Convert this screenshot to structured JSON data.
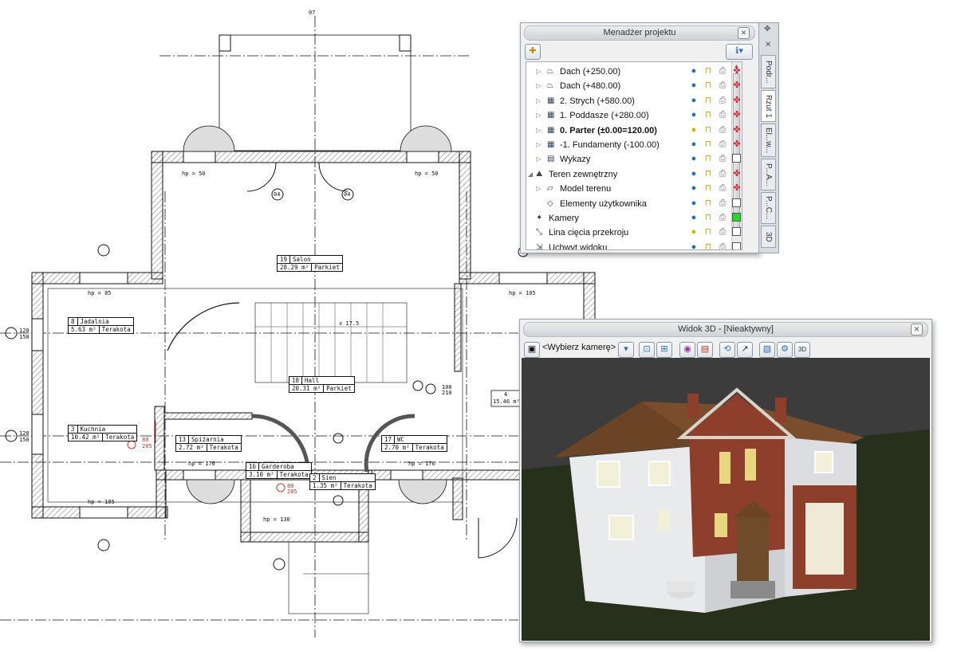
{
  "drawing": {
    "north_label": "07",
    "rooms": [
      {
        "num": "19",
        "name": "Salon",
        "area": "28.29 m²",
        "floor": "Parkiet"
      },
      {
        "num": "8",
        "name": "Jadalnia",
        "area": "5.63 m²",
        "floor": "Terakota"
      },
      {
        "num": "18",
        "name": "Hall",
        "area": "20.31 m²",
        "floor": "Parkiet"
      },
      {
        "num": "3",
        "name": "Kuchnia",
        "area": "10.42 m²",
        "floor": "Terakota"
      },
      {
        "num": "13",
        "name": "Spiżarnia",
        "area": "2.72 m²",
        "floor": "Terakota"
      },
      {
        "num": "16",
        "name": "Garderoba",
        "area": "3.10 m²",
        "floor": "Terakota"
      },
      {
        "num": "2",
        "name": "Sien",
        "area": "1.35 m²",
        "floor": "Terakota"
      },
      {
        "num": "17",
        "name": "WC",
        "area": "2.70 m²",
        "floor": "Terakota"
      },
      {
        "num": "4",
        "name": "",
        "area": "15.46 m²",
        "floor": ""
      }
    ],
    "labels": {
      "hp50a": "hp = 50",
      "hp50b": "hp = 50",
      "hp85": "hp = 85",
      "hp105a": "hp = 105",
      "hp176a": "hp = 176",
      "hp176b": "hp = 176",
      "hp105b": "hp = 105",
      "hp130": "hp = 130",
      "d04a": "04",
      "d04b": "04",
      "w120a": "120",
      "w150a": "150",
      "w120b": "120",
      "w150b": "150",
      "s175": "x 17.5",
      "r80a": "80",
      "r205a": "205",
      "r80b": "80",
      "r205b": "205",
      "d100": "100",
      "d210": "210"
    }
  },
  "project_manager": {
    "title": "Menadżer projektu",
    "tree": [
      {
        "label": "Dach (+250.00)",
        "bold": false,
        "indent": 1,
        "icon": "roof-icon",
        "bulb": "blue",
        "state": "layers"
      },
      {
        "label": "Dach (+480.00)",
        "bold": false,
        "indent": 1,
        "icon": "roof-icon",
        "bulb": "blue",
        "state": "layers"
      },
      {
        "label": "2. Strych (+580.00)",
        "bold": false,
        "indent": 1,
        "icon": "level-icon",
        "bulb": "blue",
        "state": "layers"
      },
      {
        "label": "1. Poddasze (+280.00)",
        "bold": false,
        "indent": 1,
        "icon": "level-icon",
        "bulb": "blue",
        "state": "layers"
      },
      {
        "label": "0. Parter (±0.00=120.00)",
        "bold": true,
        "indent": 1,
        "icon": "level-icon",
        "bulb": "yellow",
        "state": "layers"
      },
      {
        "label": "-1. Fundamenty (-100.00)",
        "bold": false,
        "indent": 1,
        "icon": "level-icon",
        "bulb": "blue",
        "state": "layers"
      },
      {
        "label": "Wykazy",
        "bold": false,
        "indent": 1,
        "icon": "list-icon",
        "bulb": "blue",
        "state": "white"
      },
      {
        "label": "Teren zewnętrzny",
        "bold": false,
        "indent": 0,
        "icon": "terrain-icon",
        "bulb": "blue",
        "state": "layers"
      },
      {
        "label": "Model terenu",
        "bold": false,
        "indent": 1,
        "icon": "terrain-model-icon",
        "bulb": "blue",
        "state": "layers"
      },
      {
        "label": "Elementy użytkownika",
        "bold": false,
        "indent": 1,
        "icon": "user-elements-icon",
        "bulb": "blue",
        "state": "white"
      },
      {
        "label": "Kamery",
        "bold": false,
        "indent": 0,
        "icon": "camera-icon",
        "bulb": "blue",
        "state": "green"
      },
      {
        "label": "Lina cięcia przekroju",
        "bold": false,
        "indent": 0,
        "icon": "section-line-icon",
        "bulb": "yellow",
        "state": "white"
      },
      {
        "label": "Uchwyt widoku",
        "bold": false,
        "indent": 0,
        "icon": "view-handle-icon",
        "bulb": "blue",
        "state": "white"
      }
    ]
  },
  "side_tabs": [
    "Podr...",
    "Rzut 1",
    "El...w...",
    "P...A...",
    "P...C...",
    "3D"
  ],
  "view3d": {
    "title": "Widok 3D - [Nieaktywny]",
    "camera_select": "<Wybierz kamerę>"
  },
  "colors": {
    "roof": "#6b4325",
    "wall": "#e9eaec",
    "brick": "#8e3f2c",
    "ground": "#26301a",
    "sky": "#3c3c3c"
  }
}
